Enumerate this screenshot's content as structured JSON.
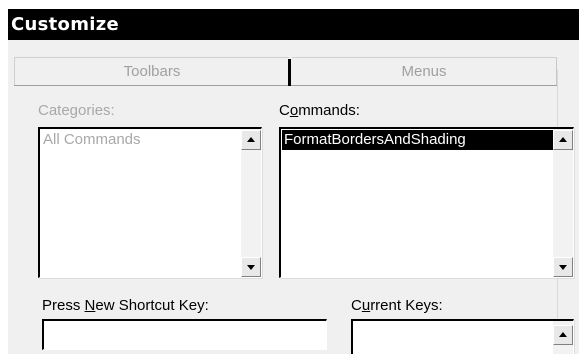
{
  "window": {
    "title": "Customize"
  },
  "tabs": [
    {
      "label": "Toolbars"
    },
    {
      "label": "Menus"
    }
  ],
  "categories": {
    "label": "Categories:",
    "items": [
      "All Commands"
    ]
  },
  "commands": {
    "label_prefix": "C",
    "label_accel": "o",
    "label_rest": "mmands:",
    "items": [
      "FormatBordersAndShading"
    ],
    "selected_index": 0
  },
  "shortcut": {
    "label_prefix": "Press ",
    "label_accel": "N",
    "label_rest": "ew Shortcut Key:",
    "value": ""
  },
  "current_keys": {
    "label_prefix": "C",
    "label_accel": "u",
    "label_rest": "rrent Keys:",
    "items": []
  },
  "icons": {
    "scroll_up": "up-arrow-icon",
    "scroll_down": "down-arrow-icon"
  },
  "colors": {
    "titlebar_bg": "#000000",
    "titlebar_text": "#ffffff",
    "selection_bg": "#000000",
    "selection_text": "#ffffff",
    "disabled_text": "#a8a8a8",
    "dialog_bg": "#f0f0f0"
  }
}
